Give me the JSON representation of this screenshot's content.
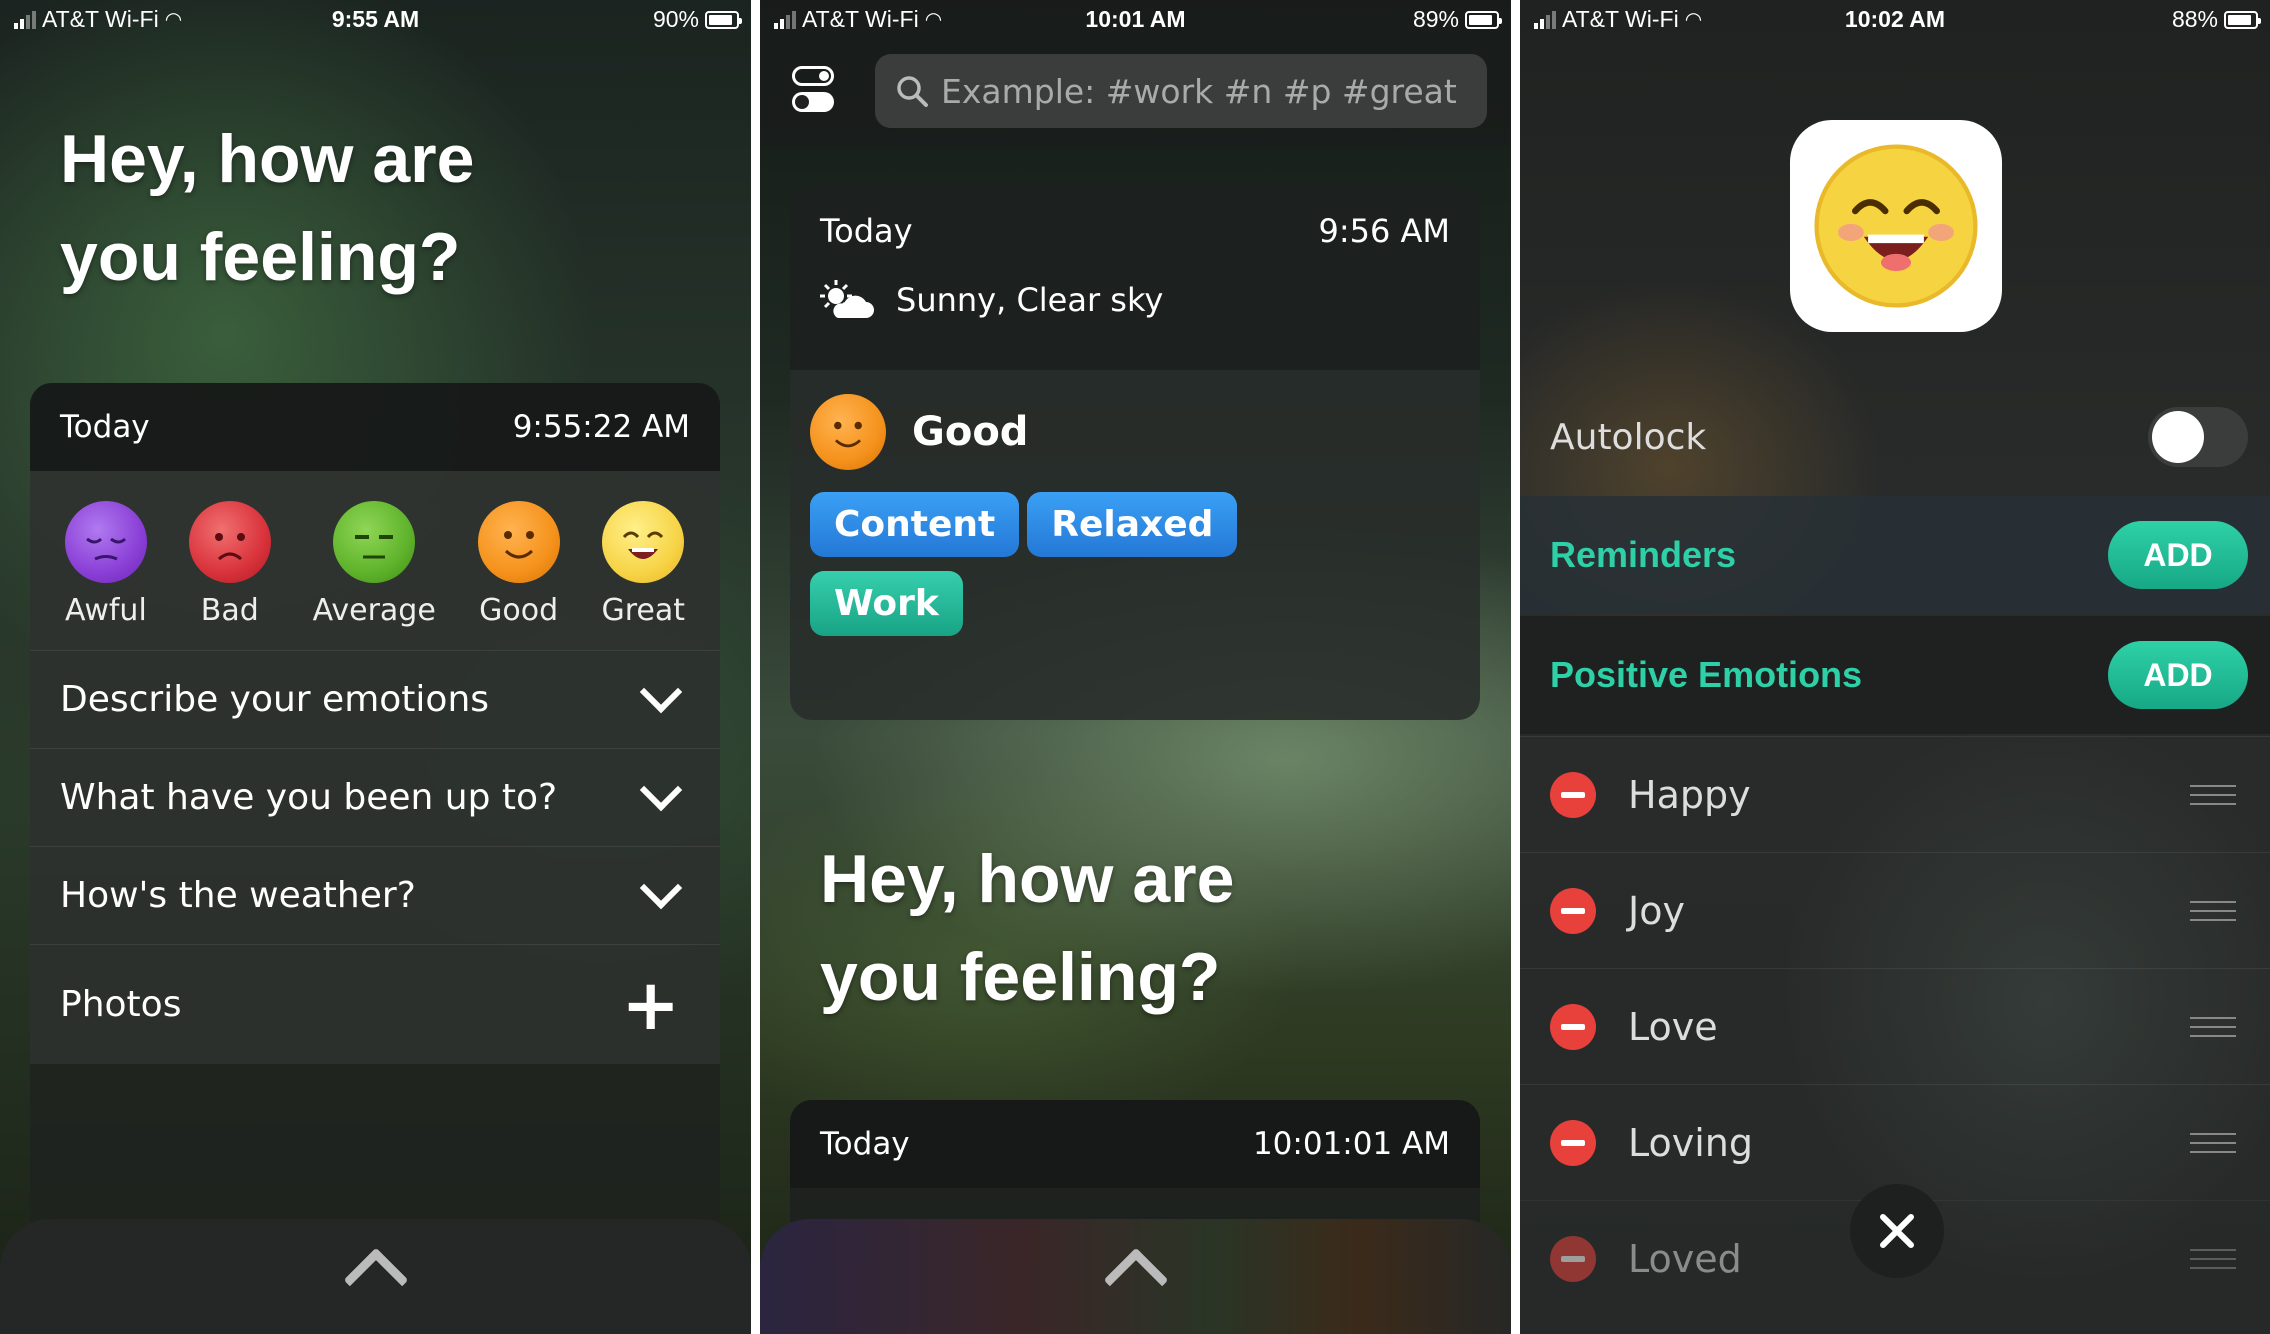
{
  "screen1": {
    "status": {
      "carrier": "AT&T Wi-Fi",
      "time": "9:55 AM",
      "battery": "90%",
      "battery_level": 0.9
    },
    "headline_line1": "Hey, how are",
    "headline_line2": "you feeling?",
    "card": {
      "day": "Today",
      "time": "9:55:22 AM",
      "moods": [
        {
          "label": "Awful",
          "color": "#8a3fd6"
        },
        {
          "label": "Bad",
          "color": "#d9323b"
        },
        {
          "label": "Average",
          "color": "#5fb32b"
        },
        {
          "label": "Good",
          "color": "#f5921c"
        },
        {
          "label": "Great",
          "color": "#f7d447"
        }
      ],
      "sections": [
        "Describe your emotions",
        "What have you been up to?",
        "How's the weather?"
      ],
      "photos_label": "Photos"
    }
  },
  "screen2": {
    "status": {
      "carrier": "AT&T Wi-Fi",
      "time": "10:01 AM",
      "battery": "89%",
      "battery_level": 0.89
    },
    "search_placeholder": "Example: #work #n #p #great",
    "entry": {
      "day": "Today",
      "time": "9:56 AM",
      "weather": "Sunny, Clear sky",
      "mood": "Good",
      "tags": [
        {
          "label": "Content",
          "color": "#2f8de6"
        },
        {
          "label": "Relaxed",
          "color": "#2f8de6"
        },
        {
          "label": "Work",
          "color": "#22b89a"
        }
      ]
    },
    "headline_line1": "Hey, how are",
    "headline_line2": "you feeling?",
    "new_card": {
      "day": "Today",
      "time": "10:01:01 AM"
    }
  },
  "screen3": {
    "status": {
      "carrier": "AT&T Wi-Fi",
      "time": "10:02 AM",
      "battery": "88%",
      "battery_level": 0.88
    },
    "autolock_label": "Autolock",
    "autolock_on": false,
    "reminders_label": "Reminders",
    "positive_label": "Positive Emotions",
    "add_label": "ADD",
    "accent": "#2ed1a7",
    "emotions": [
      "Happy",
      "Joy",
      "Love",
      "Loving",
      "Loved"
    ]
  }
}
